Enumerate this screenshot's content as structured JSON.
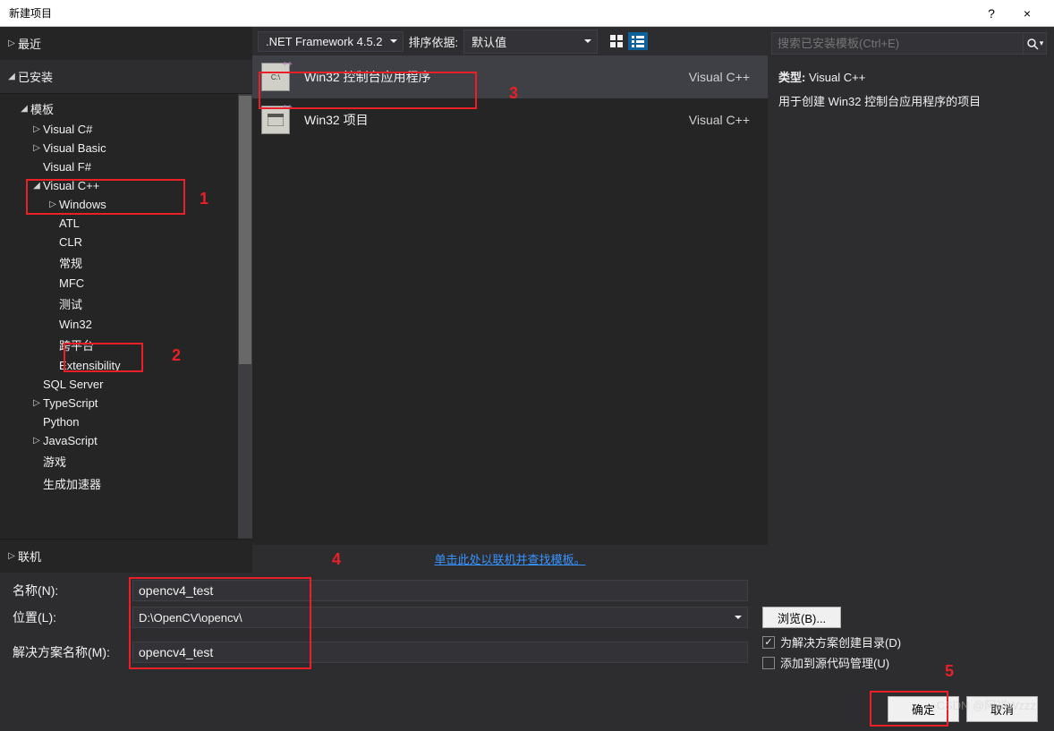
{
  "window": {
    "title": "新建项目",
    "help": "?",
    "close": "×"
  },
  "left": {
    "recent": "最近",
    "installed": "已安装",
    "online": "联机",
    "templates": "模板",
    "csharp": "Visual C#",
    "vb": "Visual Basic",
    "fsharp": "Visual F#",
    "vcpp": "Visual C++",
    "windows": "Windows",
    "atl": "ATL",
    "clr": "CLR",
    "general": "常规",
    "mfc": "MFC",
    "test": "测试",
    "win32": "Win32",
    "xplat": "跨平台",
    "ext": "Extensibility",
    "sql": "SQL Server",
    "ts": "TypeScript",
    "python": "Python",
    "js": "JavaScript",
    "game": "游戏",
    "accel": "生成加速器"
  },
  "toolbar": {
    "framework": ".NET Framework 4.5.2",
    "sortlabel": "排序依据:",
    "sortvalue": "默认值"
  },
  "templates": {
    "t1": {
      "name": "Win32 控制台应用程序",
      "lang": "Visual C++"
    },
    "t2": {
      "name": "Win32 项目",
      "lang": "Visual C++"
    }
  },
  "search": {
    "placeholder": "搜索已安装模板(Ctrl+E)"
  },
  "desc": {
    "type_label": "类型:",
    "type_value": "Visual C++",
    "body": "用于创建 Win32 控制台应用程序的项目"
  },
  "link": "单击此处以联机并查找模板。",
  "form": {
    "name_label": "名称(N):",
    "name_value": "opencv4_test",
    "loc_label": "位置(L):",
    "loc_value": "D:\\OpenCV\\opencv\\",
    "sln_label": "解决方案名称(M):",
    "sln_value": "opencv4_test",
    "browse": "浏览(B)...",
    "chk_createdir": "为解决方案创建目录(D)",
    "chk_addsrc": "添加到源代码管理(U)"
  },
  "buttons": {
    "ok": "确定",
    "cancel": "取消"
  },
  "annot": {
    "n1": "1",
    "n2": "2",
    "n3": "3",
    "n4": "4",
    "n5": "5"
  },
  "watermark": "CSDN @阿祺Wzzz",
  "icons": {
    "console": "C:\\"
  }
}
